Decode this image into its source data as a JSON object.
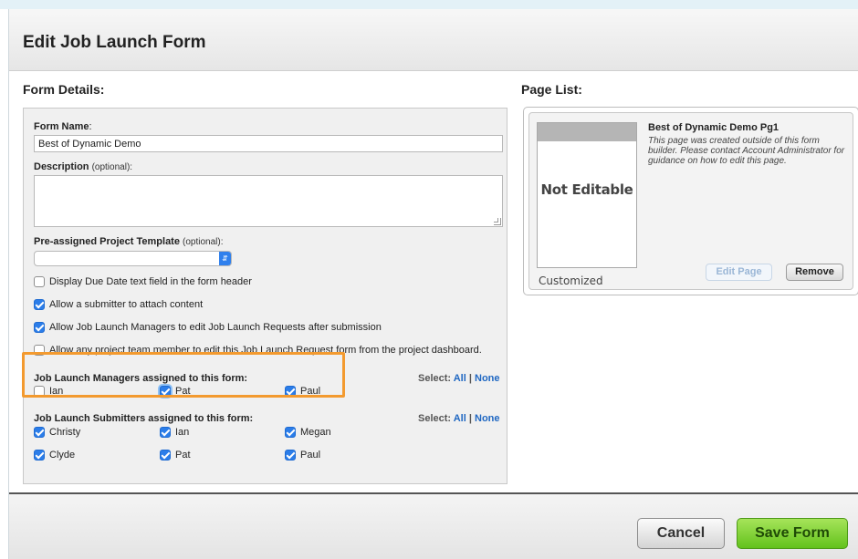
{
  "dialog": {
    "title": "Edit Job Launch Form"
  },
  "form_details": {
    "section_title": "Form Details:",
    "form_name_label": "Form Name",
    "form_name_colon": ":",
    "form_name_value": "Best of Dynamic Demo",
    "description_label": "Description",
    "description_optional": "(optional):",
    "description_value": "",
    "template_label": "Pre-assigned Project Template",
    "template_optional": "(optional):",
    "template_value": "",
    "options": [
      {
        "label": "Display Due Date text field in the form header",
        "checked": false
      },
      {
        "label": "Allow a submitter to attach content",
        "checked": true
      },
      {
        "label": "Allow Job Launch Managers to edit Job Launch Requests after submission",
        "checked": true
      },
      {
        "label": "Allow any project team member to edit this Job Launch Request form from the project dashboard.",
        "checked": false
      }
    ],
    "managers": {
      "title": "Job Launch Managers assigned to this form:",
      "select_label": "Select:",
      "all": "All",
      "sep": "|",
      "none": "None",
      "people": [
        {
          "name": "Ian",
          "checked": false
        },
        {
          "name": "Pat",
          "checked": true
        },
        {
          "name": "Paul",
          "checked": true
        }
      ]
    },
    "submitters": {
      "title": "Job Launch Submitters assigned to this form:",
      "select_label": "Select:",
      "all": "All",
      "sep": "|",
      "none": "None",
      "people": [
        {
          "name": "Christy",
          "checked": true
        },
        {
          "name": "Ian",
          "checked": true
        },
        {
          "name": "Megan",
          "checked": true
        },
        {
          "name": "Clyde",
          "checked": true
        },
        {
          "name": "Pat",
          "checked": true
        },
        {
          "name": "Paul",
          "checked": true
        }
      ]
    }
  },
  "page_list": {
    "section_title": "Page List:",
    "page": {
      "name": "Best of Dynamic Demo Pg1",
      "description": "This page was created outside of this form builder. Please contact Account Administrator for guidance on how to edit this page.",
      "thumbnail_text": "Not Editable",
      "tag": "Customized",
      "edit_label": "Edit Page",
      "remove_label": "Remove"
    }
  },
  "footer": {
    "cancel_label": "Cancel",
    "save_label": "Save Form"
  },
  "colors": {
    "accent": "#2b7de9",
    "highlight": "#f39a2f",
    "save": "#63c21c"
  }
}
